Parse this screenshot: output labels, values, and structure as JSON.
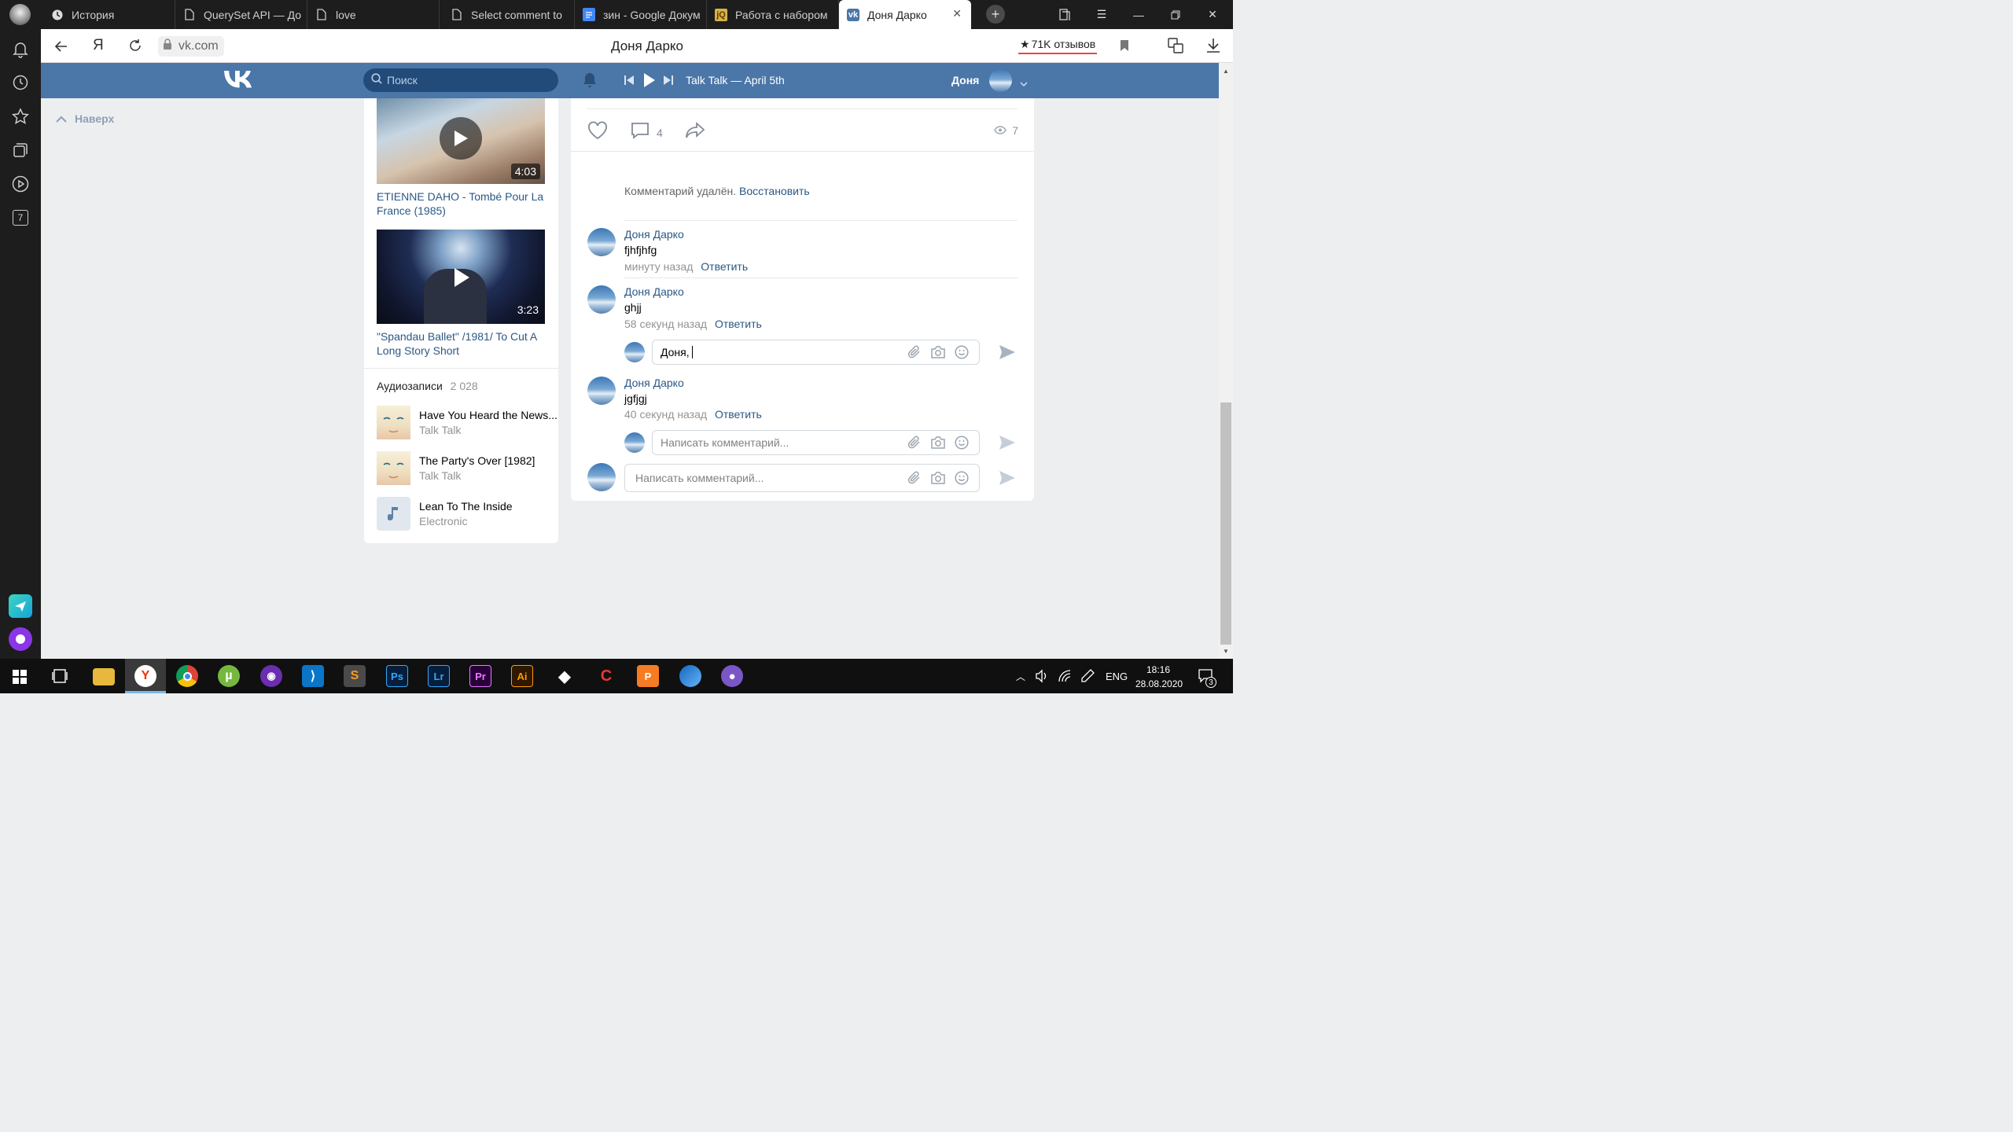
{
  "browser": {
    "tabs": [
      {
        "label": "История",
        "icon": "clock-icon"
      },
      {
        "label": "QuerySet API — До",
        "icon": "document-icon"
      },
      {
        "label": "love",
        "icon": "document-icon"
      },
      {
        "label": "Select comment to",
        "icon": "document-icon"
      },
      {
        "label": "зин - Google Докум",
        "icon": "google-docs-icon"
      },
      {
        "label": "Работа с набором",
        "icon": "jquery-icon"
      },
      {
        "label": "Доня Дарко",
        "icon": "vk-icon"
      }
    ],
    "address": "vk.com",
    "page_title": "Доня Дарко",
    "reviews": "71K отзывов",
    "yandex_letter": "Я"
  },
  "vk": {
    "search_placeholder": "Поиск",
    "player_track": "Talk Talk — April 5th",
    "user_name": "Доня",
    "back_to_top": "Наверх"
  },
  "videos": [
    {
      "title": "ETIENNE DAHO - Tombé Pour La France (1985)",
      "duration": "4:03"
    },
    {
      "title": "\"Spandau Ballet\" /1981/ To Cut A Long Story Short",
      "duration": "3:23"
    }
  ],
  "audio": {
    "header": "Аудиозаписи",
    "count": "2 028",
    "tracks": [
      {
        "title": "Have You Heard the News...",
        "artist": "Talk Talk"
      },
      {
        "title": "The Party's Over [1982]",
        "artist": "Talk Talk"
      },
      {
        "title": "Lean To The Inside",
        "artist": "Electronic"
      }
    ]
  },
  "post": {
    "comments_count": "4",
    "views": "7",
    "deleted_text": "Комментарий удалён.",
    "restore_label": "Восстановить",
    "comments": [
      {
        "author": "Доня Дарко",
        "text": "fjhfjhfg",
        "time": "минуту назад",
        "reply": "Ответить"
      },
      {
        "author": "Доня Дарко",
        "text": "ghjj",
        "time": "58 секунд назад",
        "reply": "Ответить"
      },
      {
        "author": "Доня Дарко",
        "text": "jgfjgj",
        "time": "40 секунд назад",
        "reply": "Ответить"
      }
    ],
    "reply_input_value": "Доня,",
    "comment_placeholder": "Написать комментарий..."
  },
  "taskbar": {
    "lang": "ENG",
    "time": "18:16",
    "date": "28.08.2020",
    "notifications": "3",
    "sidebar_badge": "7"
  },
  "colors": {
    "vk_blue": "#4a76a8",
    "link": "#2a5885"
  }
}
